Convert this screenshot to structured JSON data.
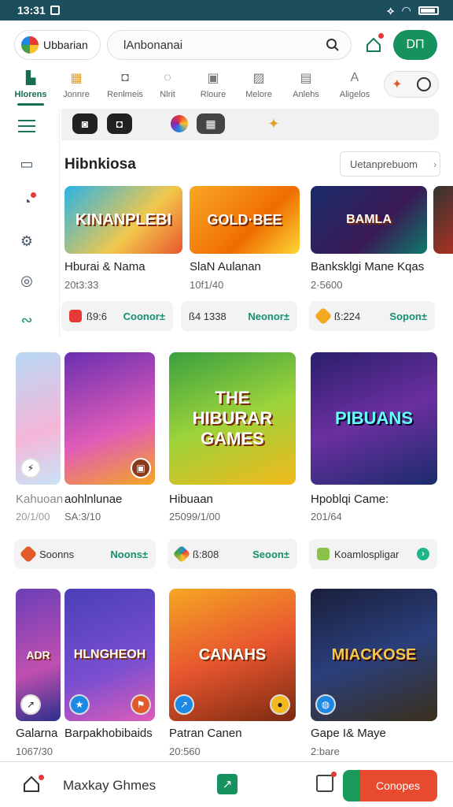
{
  "status_bar": {
    "time": "13:31"
  },
  "header": {
    "app_name": "Ubbarian",
    "search_value": "lAnbonanai",
    "account_label": "DΠ"
  },
  "tabs": [
    {
      "label": "Hlorens",
      "icon": "store-icon",
      "active": true
    },
    {
      "label": "Jonnre",
      "icon": "gift-icon"
    },
    {
      "label": "Renlmeis",
      "icon": "gamepad-icon"
    },
    {
      "label": "Nlrit",
      "icon": "compass-icon"
    },
    {
      "label": "Rloure",
      "icon": "briefcase-icon"
    },
    {
      "label": "Melore",
      "icon": "image-icon"
    },
    {
      "label": "Anlehs",
      "icon": "chart-icon"
    },
    {
      "label": "Aligelos",
      "icon": "translate-icon"
    }
  ],
  "section": {
    "title": "Hibnkiosa",
    "more_label": "Uetanprebuom"
  },
  "row1": [
    {
      "title": "Hburai & Nama",
      "sub": "20t3:33",
      "art": "KINANPLEBI",
      "chip_value": "ß9:6",
      "chip_action": "Coonor±"
    },
    {
      "title": "SlaN Aulanan",
      "sub": "10f1/40",
      "art": "GOLD·BEE",
      "chip_value": "ß4 1338",
      "chip_action": "Neonor±"
    },
    {
      "title": "Banksklgi Mane Kqas",
      "sub": "2·5600",
      "art": "BAMLA",
      "chip_value": "ß:224",
      "chip_action": "Sopon±"
    }
  ],
  "row2": [
    {
      "title": "Kahuoan",
      "sub": "20/1/00",
      "art": ""
    },
    {
      "title": "aohlnlunae",
      "sub": "SA:3/10",
      "art": ""
    },
    {
      "title": "Hibuaan",
      "sub": "25099/1/00",
      "art": "THE HIBURAR GAMES"
    },
    {
      "title": "Hpoblqi Came:",
      "sub": "201/64",
      "art": "PIBUANS"
    }
  ],
  "row2_chips": [
    {
      "value": "Soonns",
      "action": "Noons±"
    },
    {
      "value": "ß:808",
      "action": "Seoon±"
    },
    {
      "value": "Koamlospligar",
      "action": ""
    }
  ],
  "row3": [
    {
      "title": "Galarna",
      "sub": "1067/30",
      "art": "ADR"
    },
    {
      "title": "Barpakhobibaids",
      "sub": "",
      "art": "HLNGHEOH"
    },
    {
      "title": "Patran Canen",
      "sub": "20:560",
      "art": "CANAHS"
    },
    {
      "title": "Gape I& Maye",
      "sub": "2:bare",
      "art": "MIACKOSE"
    }
  ],
  "bottom_bar": {
    "title": "Maxkay Ghmes",
    "cta_label": "Conopes"
  }
}
